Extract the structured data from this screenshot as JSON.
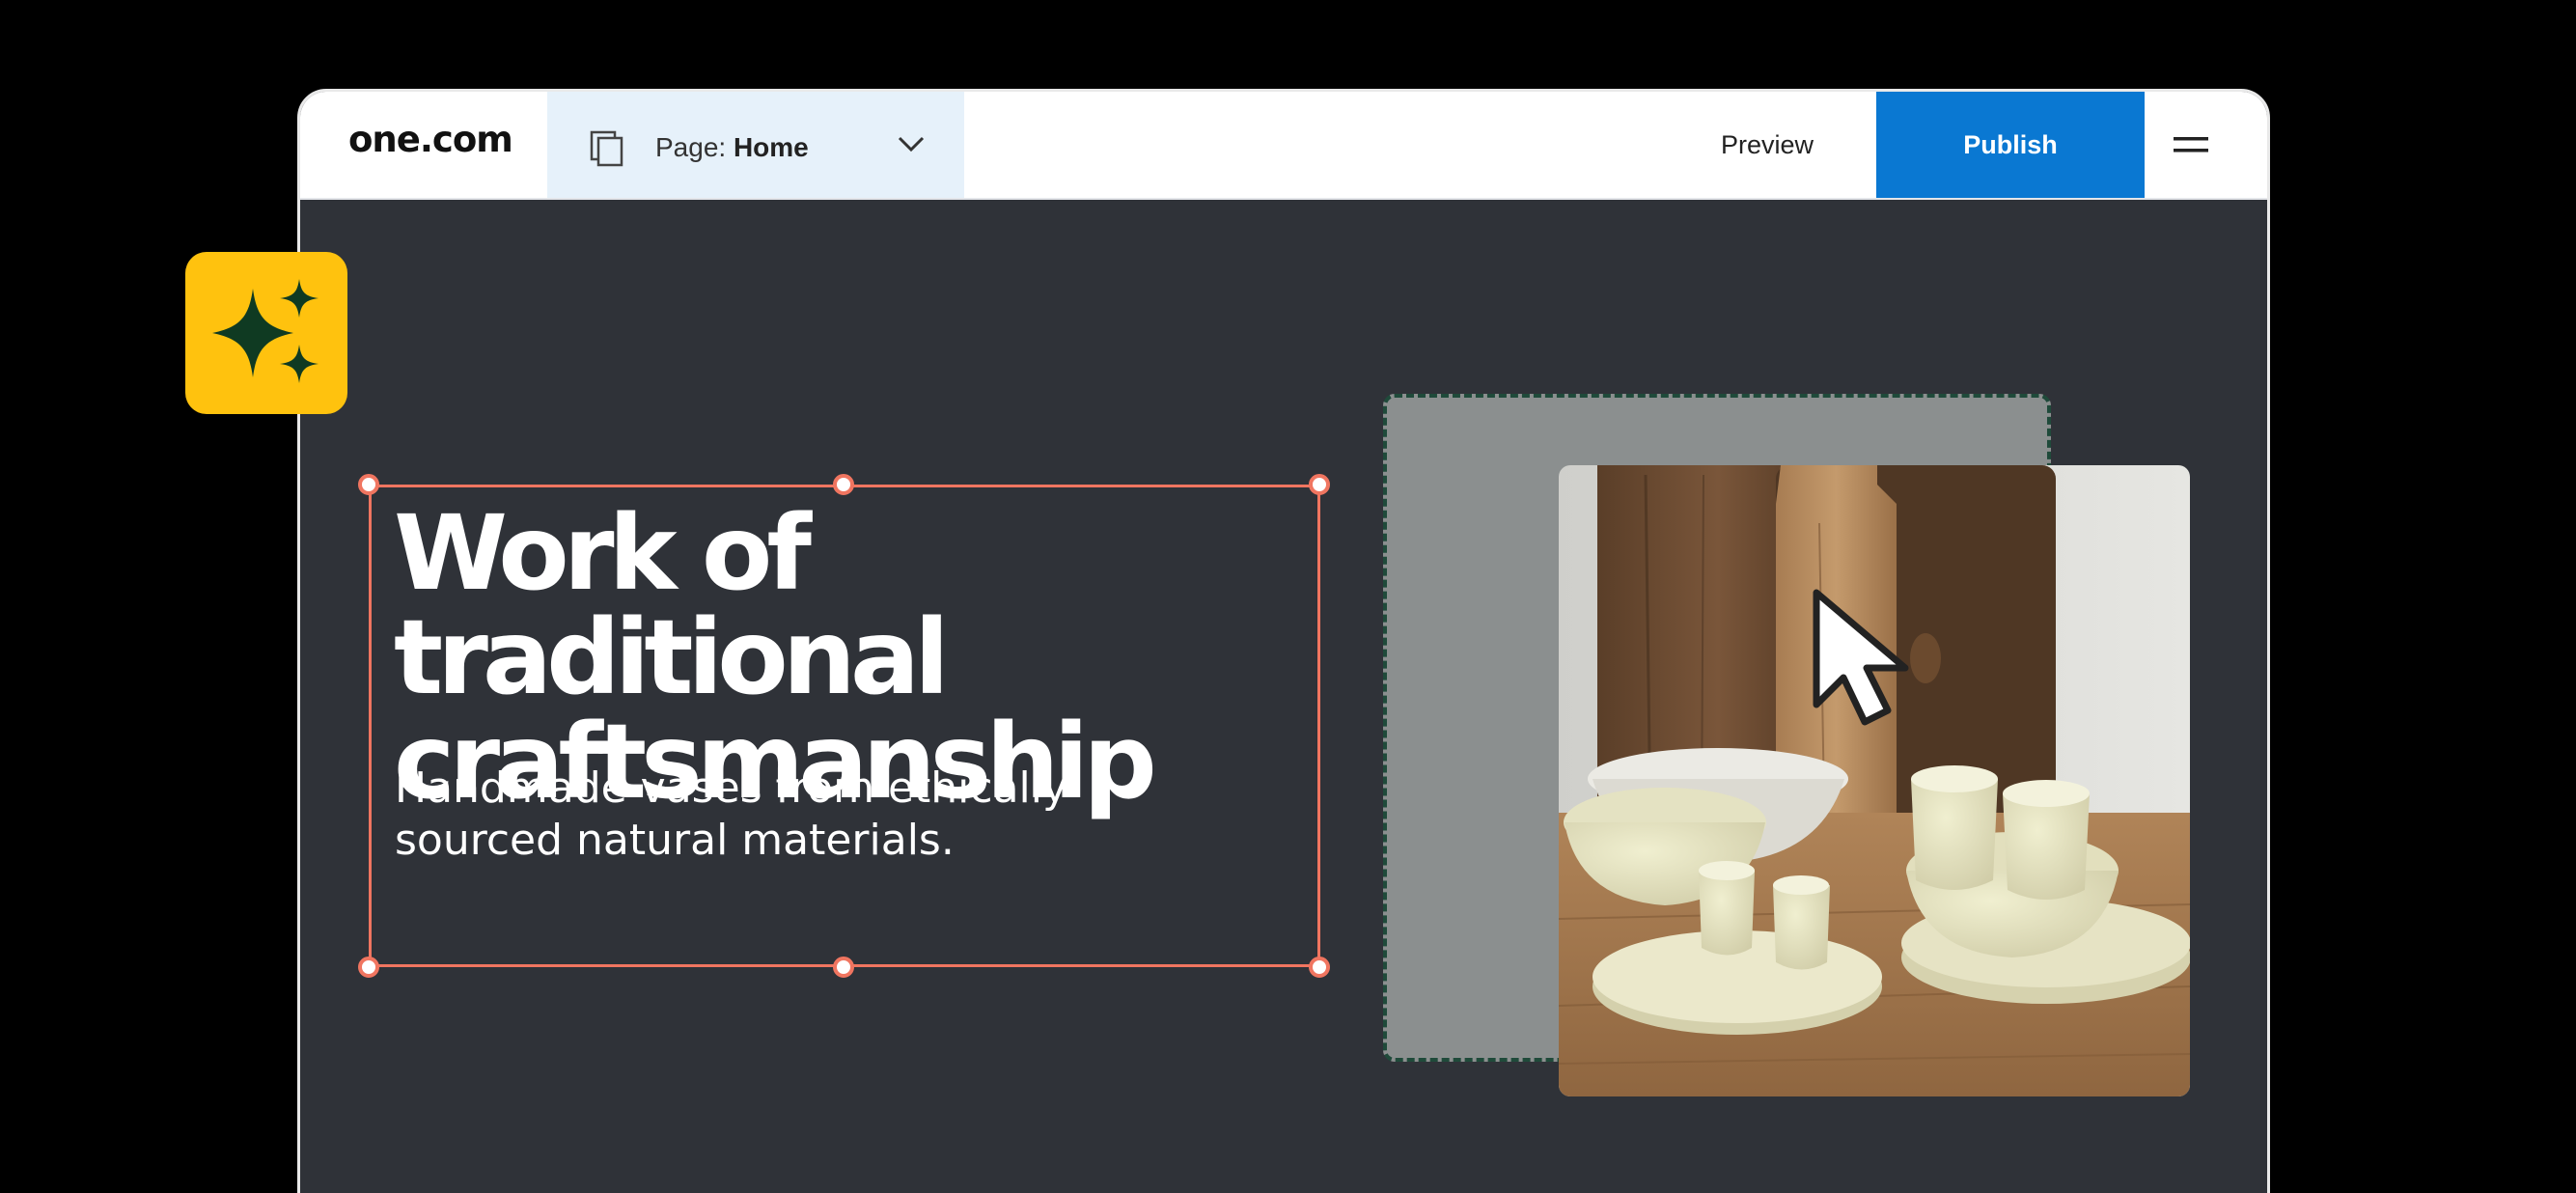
{
  "topbar": {
    "logo": "one.com",
    "page_label": "Page:",
    "page_value": "Home",
    "preview_label": "Preview",
    "publish_label": "Publish"
  },
  "hero": {
    "headline": "Work of traditional craftsmanship",
    "subtitle": "Handmade vases from ethically sourced natural materials."
  },
  "icons": {
    "ai": "sparkles-icon",
    "pages": "pages-icon",
    "dropdown": "chevron-down-icon",
    "menu": "hamburger-menu-icon",
    "pointer": "cursor-icon"
  },
  "colors": {
    "publish": "#0a78d2",
    "selection": "#f07560",
    "ai_badge": "#ffc20e",
    "canvas": "#2f3238"
  }
}
